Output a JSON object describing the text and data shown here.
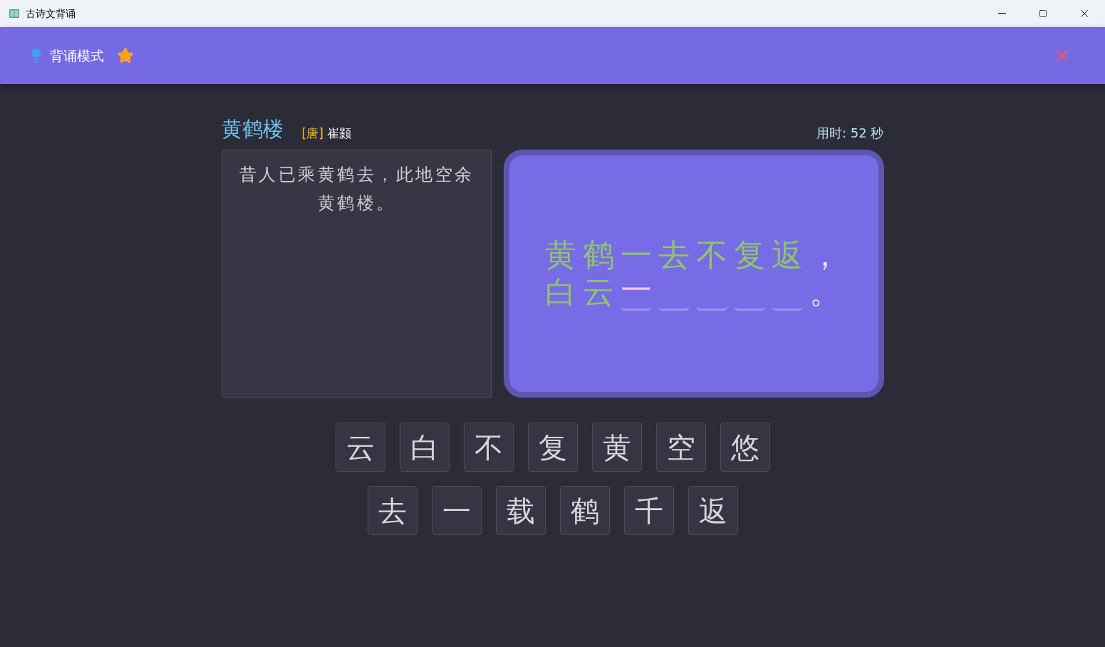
{
  "window": {
    "title": "古诗文背诵"
  },
  "header": {
    "title": "背诵模式"
  },
  "poem": {
    "title": "黄鹤楼",
    "dynasty": "[唐]",
    "author": "崔颢",
    "timer": "用时: 52 秒",
    "previous_line": "昔人已乘黄鹤去，此地空余黄鹤楼。"
  },
  "current_lines": [
    [
      {
        "kind": "text",
        "text": "黄鹤一去不复返"
      },
      {
        "kind": "punct",
        "text": "，"
      }
    ],
    [
      {
        "kind": "text",
        "text": "白云"
      },
      {
        "kind": "answer",
        "text": "一"
      },
      {
        "kind": "blank"
      },
      {
        "kind": "blank"
      },
      {
        "kind": "blank"
      },
      {
        "kind": "blank"
      },
      {
        "kind": "punct",
        "text": "。"
      }
    ]
  ],
  "choices": [
    {
      "text": "云"
    },
    {
      "text": "白"
    },
    {
      "text": "不"
    },
    {
      "text": "复"
    },
    {
      "text": "黄"
    },
    {
      "text": "空"
    },
    {
      "text": "悠"
    },
    {
      "text": "去"
    },
    {
      "text": "一"
    },
    {
      "text": "载"
    },
    {
      "text": "鹤"
    },
    {
      "text": "千"
    },
    {
      "text": "返"
    }
  ]
}
